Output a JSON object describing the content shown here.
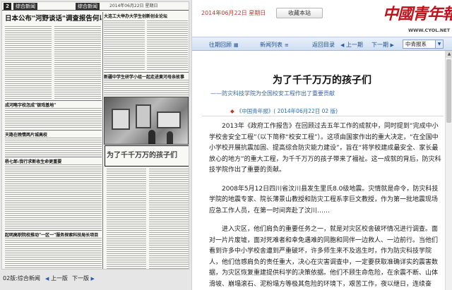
{
  "newspaper": {
    "page_number": "2",
    "section_left": "综合新闻",
    "section_right": "综合新闻",
    "masthead_date": "2014年06月22日 星期日",
    "headlines": [
      "日本公布\"河野谈话\"调查报告何以激怒韩国",
      "大连工大举办大学生创新创业论坛",
      "成河略字校怎成\"银戏基地\"",
      "天路在晚情两片城高校",
      "杨七郎:我行求新收生命更重要",
      "为了千千万万的孩子们",
      "起明高职院校推动\"一区一\"服务探索科技局长项目"
    ],
    "side_headline": "新疆中学生研学小组一起走进黄河母亲故事"
  },
  "pager": {
    "page_label": "02版:综合新闻",
    "prev_label": "上一版",
    "next_label": "下一版"
  },
  "header": {
    "date": "2014年06月22日  星期日",
    "favorite_label": "收藏本站",
    "logo_text": "中國青年報",
    "logo_url": "WWW.CYOL.NET"
  },
  "nav": {
    "items": [
      "往期回顾",
      "新闻列表",
      "返回目录"
    ],
    "prev_page": "上一期",
    "next_page": "下一期",
    "edition_select": "中青报系"
  },
  "article": {
    "title": "为了千千万万的孩子们",
    "subtitle": "——防灾科技学院为全国校安工程作出了重要贡献",
    "source": "《中国青年报》( 2014年06月22日    02 版)",
    "paragraphs": [
      "2013年《政府工作报告》在回顾过去五年工作的成就中，同时提到“完成中小学校舍安全工程”（以下简称“校安工程”）。这项由国家作出的重大决定，“在全国中小学校开展抗震加固、提高综合防灾能力建设”，旨在“将学校建成最安全、家长最放心的地方”的重大工程，为千千万万的孩子带来了福祉。这一成就的背后，防灾科技学院作出了重要的贡献。",
      "2008年5月12日四川省汶川县发生里氏8.0级地震。灾情就是命令，防灾科技学院的地震专家、院长薄景山教授和防灾工程系李巨文教授，作为第一批地震现场应急工作人员，在第一时间奔赴了汶川……",
      "进入灾区，他们肩负的重要任务之一，就是对灾区校舍破坏情况进行调查。面对一片片废墟，面对死难者和幸免遇难的同胞和同伴一边救人、一边前行。当他们看到许多中小学校舍遭到严重破坏，许多师生来不及逃生时，作为防灾科技学院人，他们信感肩负的责任重大，决心在灾害调查中，一定要获取准确详实的震害数据，为灾区恢复重建提供科学的决策依据。他们不顾生命危险，在余震不断、山体滑坡、崩塌滚石、泥粉塌方等极其危险的环境下，艰苦工作，夜以继日，连续奋战，向重灾区投"
    ]
  }
}
